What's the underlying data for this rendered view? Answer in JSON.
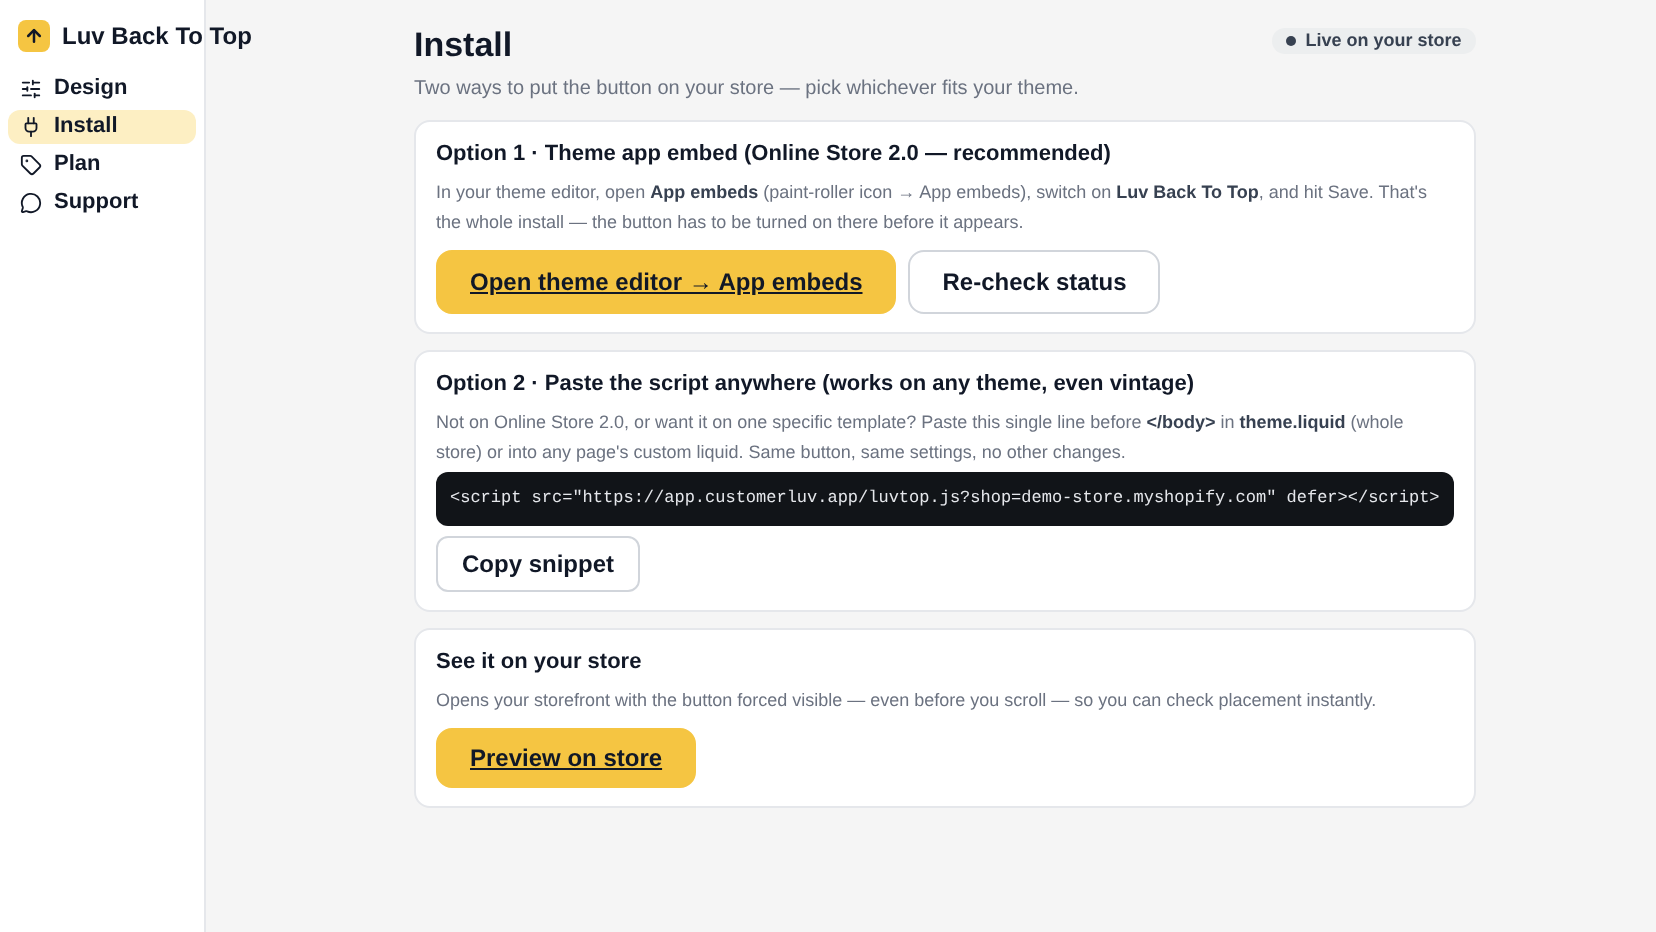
{
  "sidebar": {
    "brand": "Luv Back To Top",
    "items": [
      {
        "label": "Design",
        "selected": false
      },
      {
        "label": "Install",
        "selected": true
      },
      {
        "label": "Plan",
        "selected": false
      },
      {
        "label": "Support",
        "selected": false
      }
    ]
  },
  "header": {
    "title": "Install",
    "subtitle": "Two ways to put the button on your store — pick whichever fits your theme.",
    "status": {
      "label": "Live on your store",
      "color": "#374151"
    }
  },
  "cards": [
    {
      "title": "Option 1 · Theme app embed (Online Store 2.0 — recommended)",
      "text": "In your theme editor, open **App embeds** (paint-roller icon → App embeds), switch on **Luv Back To Top**, and hit Save. That's the whole install — the button has to be turned on there before it appears.",
      "buttons": [
        {
          "label": "Open theme editor → App embeds",
          "kind": "primary"
        },
        {
          "label": "Re-check status",
          "kind": "secondary"
        }
      ]
    },
    {
      "title": "Option 2 · Paste the script anywhere (works on any theme, even vintage)",
      "text": "Not on Online Store 2.0, or want it on one specific template? Paste this single line before **</body>** in **theme.liquid** (whole store) or into any page's custom liquid. Same button, same settings, no other changes.",
      "code": "<script src=\"https://app.customerluv.app/luvtop.js?shop=demo-store.myshopify.com\" defer></script>",
      "buttons": [
        {
          "label": "Copy snippet",
          "kind": "small"
        }
      ]
    },
    {
      "title": "See it on your store",
      "text": "Opens your storefront with the button forced visible — even before you scroll — so you can check placement instantly.",
      "buttons": [
        {
          "label": "Preview on store",
          "kind": "primary"
        }
      ]
    }
  ]
}
